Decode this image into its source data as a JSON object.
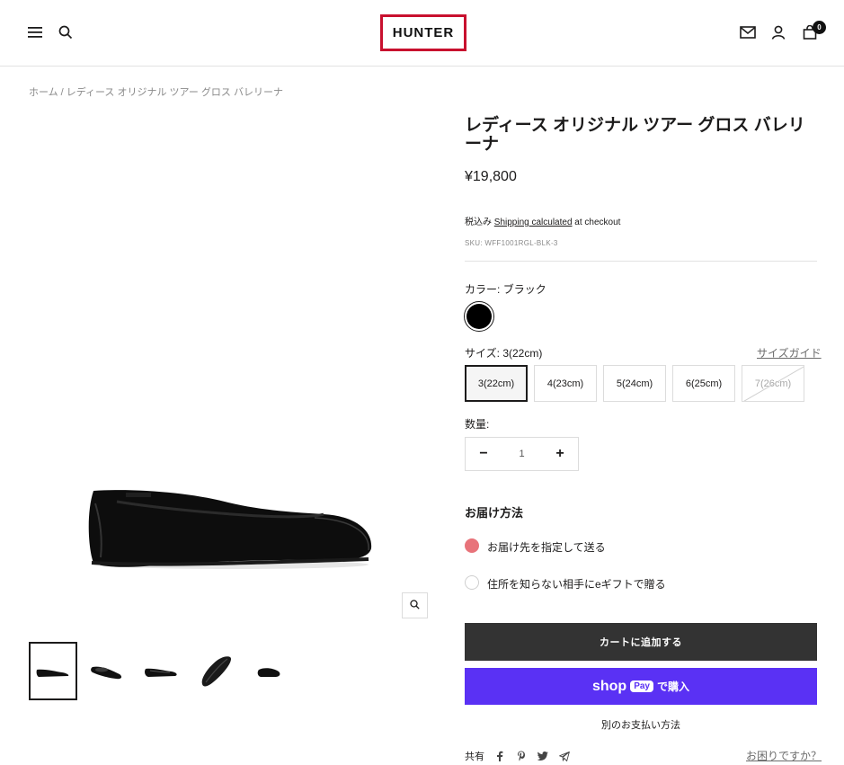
{
  "header": {
    "logo_text": "HUNTER",
    "cart_count": "0",
    "icons": [
      "menu-icon",
      "search-icon",
      "mail-icon",
      "account-icon",
      "cart-icon"
    ],
    "logo_border_color": "#c8102e"
  },
  "breadcrumb": {
    "home": "ホーム",
    "separator": "/",
    "current": "レディース オリジナル ツアー グロス バレリーナ"
  },
  "gallery": {
    "zoom_icon": "zoom-icon",
    "thumbnail_count": 5,
    "active_thumbnail": 1
  },
  "product": {
    "title": "レディース オリジナル ツアー グロス バレリーナ",
    "price": "¥19,800",
    "tax_prefix": "税込み",
    "shipping_link": "Shipping calculated",
    "tax_suffix": "at checkout",
    "sku": "SKU: WFF1001RGL-BLK-3"
  },
  "options": {
    "color_label": "カラー:",
    "color_value": "ブラック",
    "color_swatch": "#000000",
    "size_label": "サイズ:",
    "size_value": "3(22cm)",
    "size_guide": "サイズガイド",
    "sizes": [
      {
        "label": "3(22cm)",
        "state": "selected"
      },
      {
        "label": "4(23cm)",
        "state": "available"
      },
      {
        "label": "5(24cm)",
        "state": "available"
      },
      {
        "label": "6(25cm)",
        "state": "available"
      },
      {
        "label": "7(26cm)",
        "state": "sold-out"
      }
    ],
    "quantity_label": "数量:",
    "quantity_value": "1",
    "minus": "−",
    "plus": "+"
  },
  "delivery": {
    "title": "お届け方法",
    "options": [
      {
        "label": "お届け先を指定して送る",
        "selected": true
      },
      {
        "label": "住所を知らない相手にeギフトで贈る",
        "selected": false
      }
    ],
    "selected_color": "#e8737a"
  },
  "actions": {
    "add_to_cart": "カートに追加する",
    "shop_word": "shop",
    "pay_chip": "Pay",
    "shop_buy": "で購入",
    "more_payment": "別のお支払い方法",
    "add_to_cart_color": "#333333",
    "shop_pay_color": "#5a31f4"
  },
  "footer": {
    "share_label": "共有",
    "share_icons": [
      "facebook-icon",
      "pinterest-icon",
      "twitter-icon",
      "email-share-icon"
    ],
    "help": "お困りですか？"
  }
}
